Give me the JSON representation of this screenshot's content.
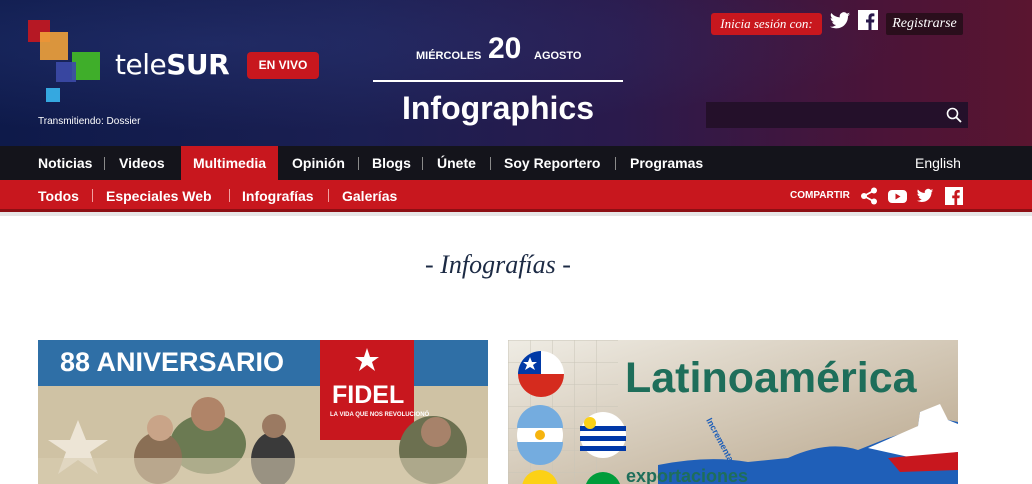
{
  "header": {
    "logo": {
      "text_light": "tele",
      "text_bold": "SUR"
    },
    "live_button": "EN VIVO",
    "transmitting": "Transmitiendo: Dossier",
    "date": {
      "weekday": "MIÉRCOLES",
      "day": "20",
      "month": "AGOSTO"
    },
    "section_title": "Infographics",
    "login_label": "Inicia sesión con:",
    "register_label": "Registrarse",
    "search": {
      "placeholder": "",
      "value": ""
    }
  },
  "main_nav": {
    "items": [
      {
        "label": "Noticias",
        "active": false
      },
      {
        "label": "Videos",
        "active": false
      },
      {
        "label": "Multimedia",
        "active": true
      },
      {
        "label": "Opinión",
        "active": false
      },
      {
        "label": "Blogs",
        "active": false
      },
      {
        "label": "Únete",
        "active": false
      },
      {
        "label": "Soy Reportero",
        "active": false
      },
      {
        "label": "Programas",
        "active": false
      }
    ],
    "language": "English"
  },
  "sub_nav": {
    "items": [
      {
        "label": "Todos"
      },
      {
        "label": "Especiales Web"
      },
      {
        "label": "Infografías"
      },
      {
        "label": "Galerías"
      }
    ],
    "share_label": "COMPARTIR",
    "share_icons": [
      "share-icon",
      "youtube-icon",
      "twitter-icon",
      "facebook-icon"
    ]
  },
  "content": {
    "heading": "- Infografías -",
    "cards": [
      {
        "banner": "88 ANIVERSARIO",
        "badge_title": "FIDEL",
        "badge_subtitle": "LA VIDA QUE NOS REVOLUCIONÓ"
      },
      {
        "title": "Latinoamérica",
        "rotated_label": "Incrementa",
        "subtitle": "exportaciones"
      }
    ]
  },
  "colors": {
    "brand_red": "#c8171e",
    "nav_dark": "#14141b",
    "header_navy": "#0e1a4a",
    "heading_text": "#1c2a44"
  }
}
